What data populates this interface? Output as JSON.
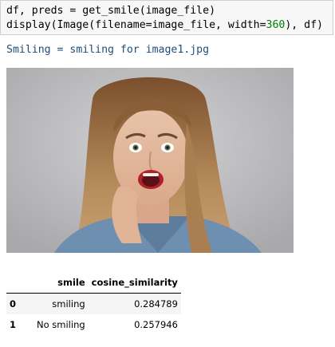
{
  "code": {
    "line1_prefix": "df, preds = get_smile(image_file)",
    "line2_prefix": "display(Image(filename=image_file, width=",
    "line2_number": "360",
    "line2_suffix": "), df)"
  },
  "output": {
    "text": "Smiling = smiling for image1.jpg"
  },
  "image": {
    "subject": "woman-surprised-smiling-photo"
  },
  "table": {
    "index_header": "",
    "columns": [
      "smile",
      "cosine_similarity"
    ],
    "rows": [
      {
        "index": "0",
        "smile": "smiling",
        "cosine_similarity": "0.284789"
      },
      {
        "index": "1",
        "smile": "No smiling",
        "cosine_similarity": "0.257946"
      }
    ]
  },
  "colors": {
    "output_text": "#1f4e79",
    "code_number": "#008000",
    "code_background": "#f7f7f7"
  }
}
